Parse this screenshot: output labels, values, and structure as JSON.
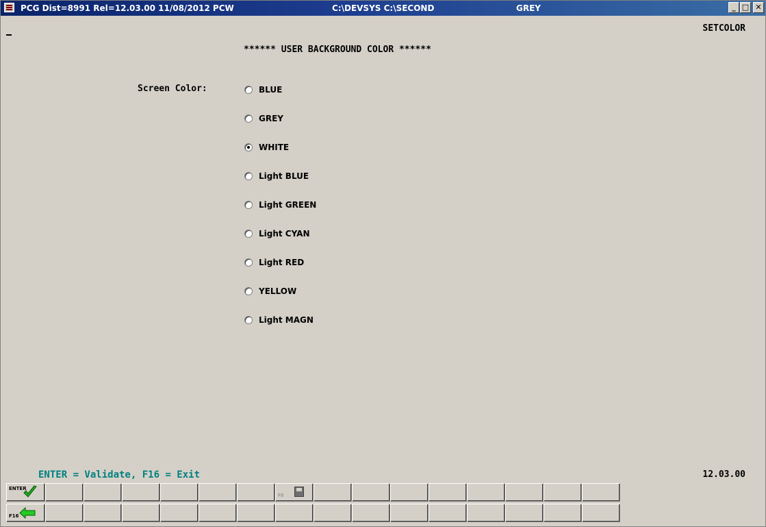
{
  "titlebar": {
    "segment1": "PCG Dist=8991  Rel=12.03.00  11/08/2012  PCW",
    "segment2": "C:\\DEVSYS  C:\\SECOND",
    "segment3": "GREY",
    "minimize": "_",
    "maximize": "□",
    "close": "✕"
  },
  "form_id": "SETCOLOR",
  "page_title": "****** USER BACKGROUND COLOR ******",
  "screen_color_label": "Screen Color:",
  "color_options": [
    {
      "label": "BLUE",
      "checked": false
    },
    {
      "label": "GREY",
      "checked": false
    },
    {
      "label": "WHITE",
      "checked": true
    },
    {
      "label": "Light BLUE",
      "checked": false
    },
    {
      "label": "Light GREEN",
      "checked": false
    },
    {
      "label": "Light CYAN",
      "checked": false
    },
    {
      "label": "Light RED",
      "checked": false
    },
    {
      "label": "YELLOW",
      "checked": false
    },
    {
      "label": "Light MAGN",
      "checked": false
    }
  ],
  "hint": "ENTER = Validate, F16 = Exit",
  "version": "12.03.00",
  "keys": {
    "enter_label": "ENTER",
    "f8_label": "F8",
    "f16_label": "F16"
  },
  "icons": {
    "enter": "check-icon",
    "f8": "save-disk-icon",
    "f16": "back-arrow-icon"
  },
  "colors": {
    "background": "#d4d0c8",
    "titlebar": "#0a246a",
    "hint_text": "#008080",
    "check": "#22aa22",
    "arrow": "#22cc22"
  }
}
